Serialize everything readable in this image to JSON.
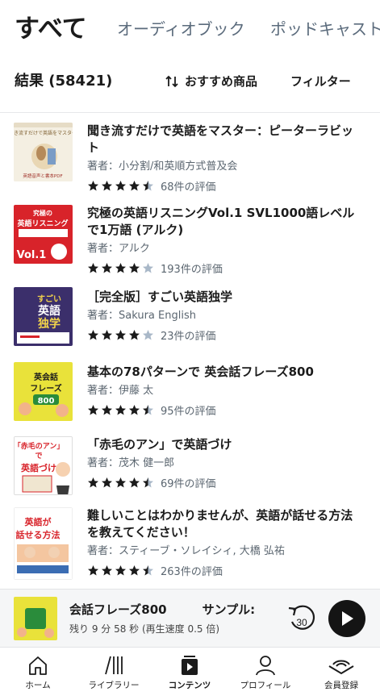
{
  "tabs": [
    {
      "label": "すべて"
    },
    {
      "label": "オーディオブック"
    },
    {
      "label": "ポッドキャスト"
    }
  ],
  "results": {
    "title": "結果 (58421)",
    "sort_label": "おすすめ商品",
    "filter_label": "フィルター"
  },
  "items": [
    {
      "title": "聞き流すだけで英語をマスター：ピーターラビット",
      "author": "著者：小分割/和英順方式普及会",
      "rating": 4.5,
      "rating_text": "68件の評価",
      "cover": {
        "bg": "#f3ede0",
        "accent": "#c9a15a",
        "line1": "聞き流すだけで英語をマスター",
        "line2": "英語音声と書本PDF"
      }
    },
    {
      "title": "究極の英語リスニングVol.1 SVL1000語レベルで1万語 (アルク)",
      "author": "著者：アルク",
      "rating": 4,
      "rating_text": "193件の評価",
      "cover": {
        "bg": "#d8232a",
        "accent": "#ffffff",
        "line1": "究極の",
        "line2": "英語リスニング",
        "line3": "Vol.1"
      }
    },
    {
      "title": "［完全版］すごい英語独学",
      "author": "著者：Sakura English",
      "rating": 4,
      "rating_text": "23件の評価",
      "cover": {
        "bg": "#3b2f6b",
        "accent": "#f2d34b",
        "line1": "すごい",
        "line2": "英語",
        "line3": "独学"
      }
    },
    {
      "title": "基本の78パターンで 英会話フレーズ800",
      "author": "著者：伊藤 太",
      "rating": 4.5,
      "rating_text": "95件の評価",
      "cover": {
        "bg": "#e9e23a",
        "accent": "#2a8c3b",
        "line1": "英会話",
        "line2": "フレーズ",
        "line3": "800"
      }
    },
    {
      "title": "「赤毛のアン」で英語づけ",
      "author": "著者：茂木 健一郎",
      "rating": 4.5,
      "rating_text": "69件の評価",
      "cover": {
        "bg": "#ffffff",
        "accent": "#d8232a",
        "line1": "「赤毛のアン」",
        "line2": "で",
        "line3": "英語づけ"
      }
    },
    {
      "title": "難しいことはわかりませんが、英語が話せる方法を教えてください！",
      "author": "著者：スティーブ・ソレイシィ, 大橋 弘祐",
      "rating": 4.5,
      "rating_text": "263件の評価",
      "cover": {
        "bg": "#ffffff",
        "accent": "#d8232a",
        "line1": "英語が",
        "line2": "話せる方法"
      }
    }
  ],
  "player": {
    "title": "会話フレーズ800",
    "sample_label": "サンプル:",
    "subtitle": "残り 9 分 58 秒 (再生速度 0.5 倍)",
    "skip_label": "30"
  },
  "nav": [
    {
      "label": "ホーム",
      "icon": "home-icon"
    },
    {
      "label": "ライブラリー",
      "icon": "library-icon"
    },
    {
      "label": "コンテンツ",
      "icon": "content-icon"
    },
    {
      "label": "プロフィール",
      "icon": "profile-icon"
    },
    {
      "label": "会員登録",
      "icon": "audible-icon"
    }
  ],
  "colors": {
    "star": "#1b1b1b",
    "star_empty": "#a9b8c8",
    "accent_text": "#5b6b7c"
  }
}
